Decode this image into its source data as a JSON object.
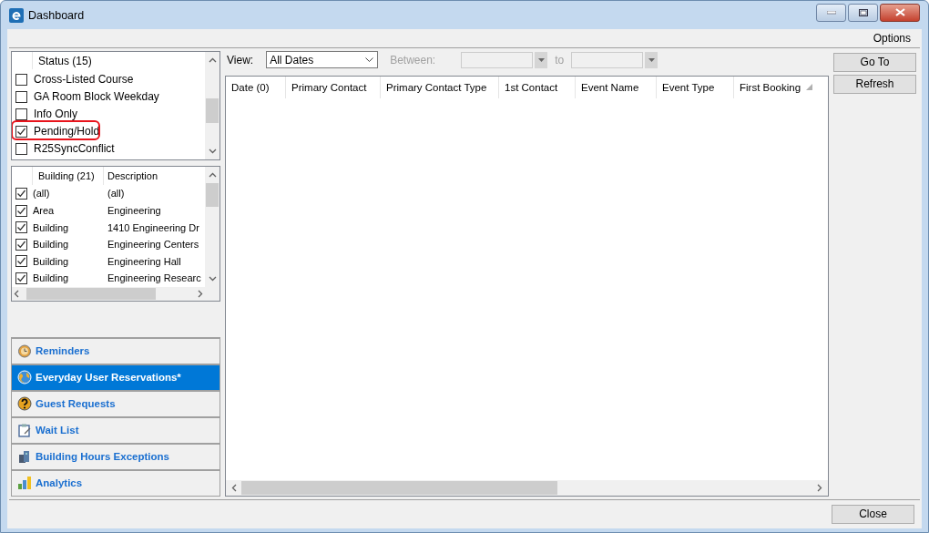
{
  "window": {
    "title": "Dashboard"
  },
  "menu": [
    "Options"
  ],
  "status_list": {
    "header": "Status (15)",
    "items": [
      {
        "label": "Cross-Listed Course",
        "checked": false,
        "highlighted": false
      },
      {
        "label": "GA Room Block Weekday",
        "checked": false,
        "highlighted": false
      },
      {
        "label": "Info Only",
        "checked": false,
        "highlighted": false
      },
      {
        "label": "Pending/Hold",
        "checked": true,
        "highlighted": true
      },
      {
        "label": "R25SyncConflict",
        "checked": false,
        "highlighted": false
      }
    ]
  },
  "building_list": {
    "columns": [
      "Building (21)",
      "Description"
    ],
    "rows": [
      {
        "building": "(all)",
        "description": "(all)",
        "checked": true
      },
      {
        "building": "Area",
        "description": "Engineering",
        "checked": true
      },
      {
        "building": "Building",
        "description": "1410 Engineering Dr",
        "checked": true
      },
      {
        "building": "Building",
        "description": "Engineering Centers",
        "checked": true
      },
      {
        "building": "Building",
        "description": "Engineering Hall",
        "checked": true
      },
      {
        "building": "Building",
        "description": "Engineering Researc",
        "checked": true
      }
    ]
  },
  "nav": [
    {
      "label": "Reminders",
      "selected": false
    },
    {
      "label": "Everyday User Reservations*",
      "selected": true
    },
    {
      "label": "Guest Requests",
      "selected": false
    },
    {
      "label": "Wait List",
      "selected": false
    },
    {
      "label": "Building Hours Exceptions",
      "selected": false
    },
    {
      "label": "Analytics",
      "selected": false
    }
  ],
  "view": {
    "label": "View:",
    "value": "All Dates"
  },
  "between": {
    "label": "Between:",
    "to_label": "to",
    "disabled": true
  },
  "grid": {
    "columns": [
      "Date (0)",
      "Primary Contact",
      "Primary Contact Type",
      "1st Contact",
      "Event Name",
      "Event Type",
      "First Booking"
    ]
  },
  "buttons": [
    "Go To",
    "Refresh"
  ],
  "close_button": "Close"
}
